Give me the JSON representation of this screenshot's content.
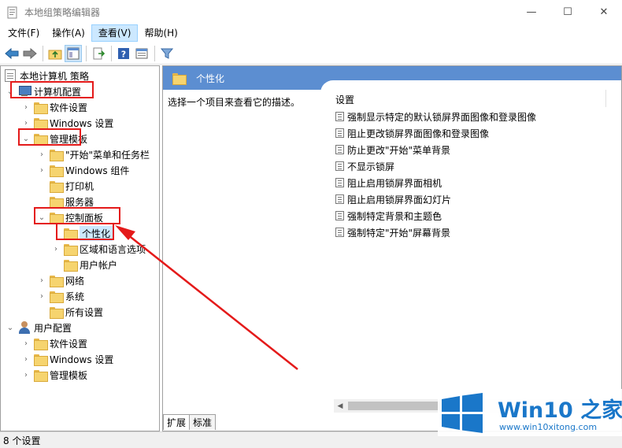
{
  "window": {
    "title": "本地组策略编辑器",
    "minimize": "—",
    "maximize": "☐",
    "close": "✕"
  },
  "menu": [
    "文件(F)",
    "操作(A)",
    "查看(V)",
    "帮助(H)"
  ],
  "tree": {
    "root": "本地计算机 策略",
    "computer_config": "计算机配置",
    "software_settings": "软件设置",
    "windows_settings": "Windows 设置",
    "admin_templates": "管理模板",
    "start_menu": "\"开始\"菜单和任务栏",
    "windows_components": "Windows 组件",
    "printers": "打印机",
    "servers": "服务器",
    "control_panel": "控制面板",
    "personalization": "个性化",
    "region_language": "区域和语言选项",
    "user_accounts": "用户帐户",
    "network": "网络",
    "system": "系统",
    "all_settings": "所有设置",
    "user_config": "用户配置",
    "user_software_settings": "软件设置",
    "user_windows_settings": "Windows 设置",
    "user_admin_templates": "管理模板"
  },
  "right_pane": {
    "header_title": "个性化",
    "description": "选择一个项目来查看它的描述。",
    "column_header": "设置",
    "settings": [
      "强制显示特定的默认锁屏界面图像和登录图像",
      "阻止更改锁屏界面图像和登录图像",
      "防止更改\"开始\"菜单背景",
      "不显示锁屏",
      "阻止启用锁屏界面相机",
      "阻止启用锁屏界面幻灯片",
      "强制特定背景和主题色",
      "强制特定\"开始\"屏幕背景"
    ],
    "tabs": [
      "扩展",
      "标准"
    ]
  },
  "status": "8 个设置",
  "watermark": {
    "title": "Win10 之家",
    "url": "www.win10xitong.com"
  },
  "colors": {
    "header_blue": "#5c8ed1",
    "annotation_red": "#e41a1a",
    "watermark_blue": "#1a77c9"
  }
}
